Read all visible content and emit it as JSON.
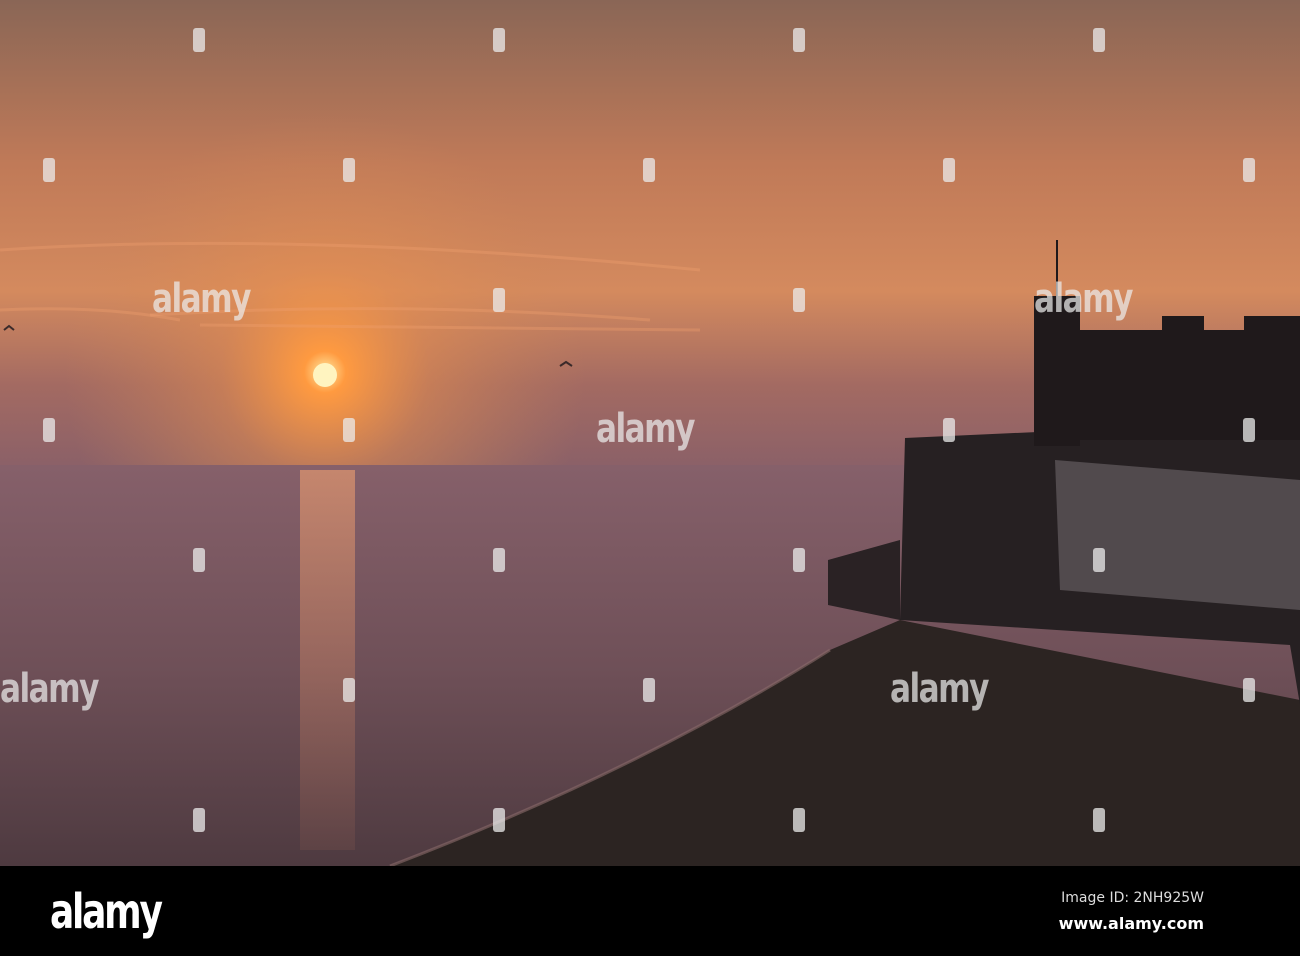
{
  "photo": {
    "description_colors": {
      "sky_top": "#8b6a5a",
      "sky_glow": "#e0905a",
      "sun": "#fff0b0",
      "sea": "#7a5a62",
      "beach": "#2b2220",
      "silhouette": "#1f191b"
    }
  },
  "watermark": {
    "text": "alamy"
  },
  "footer": {
    "logo": "alamy",
    "image_id": "Image ID: 2NH925W",
    "url": "www.alamy.com"
  }
}
